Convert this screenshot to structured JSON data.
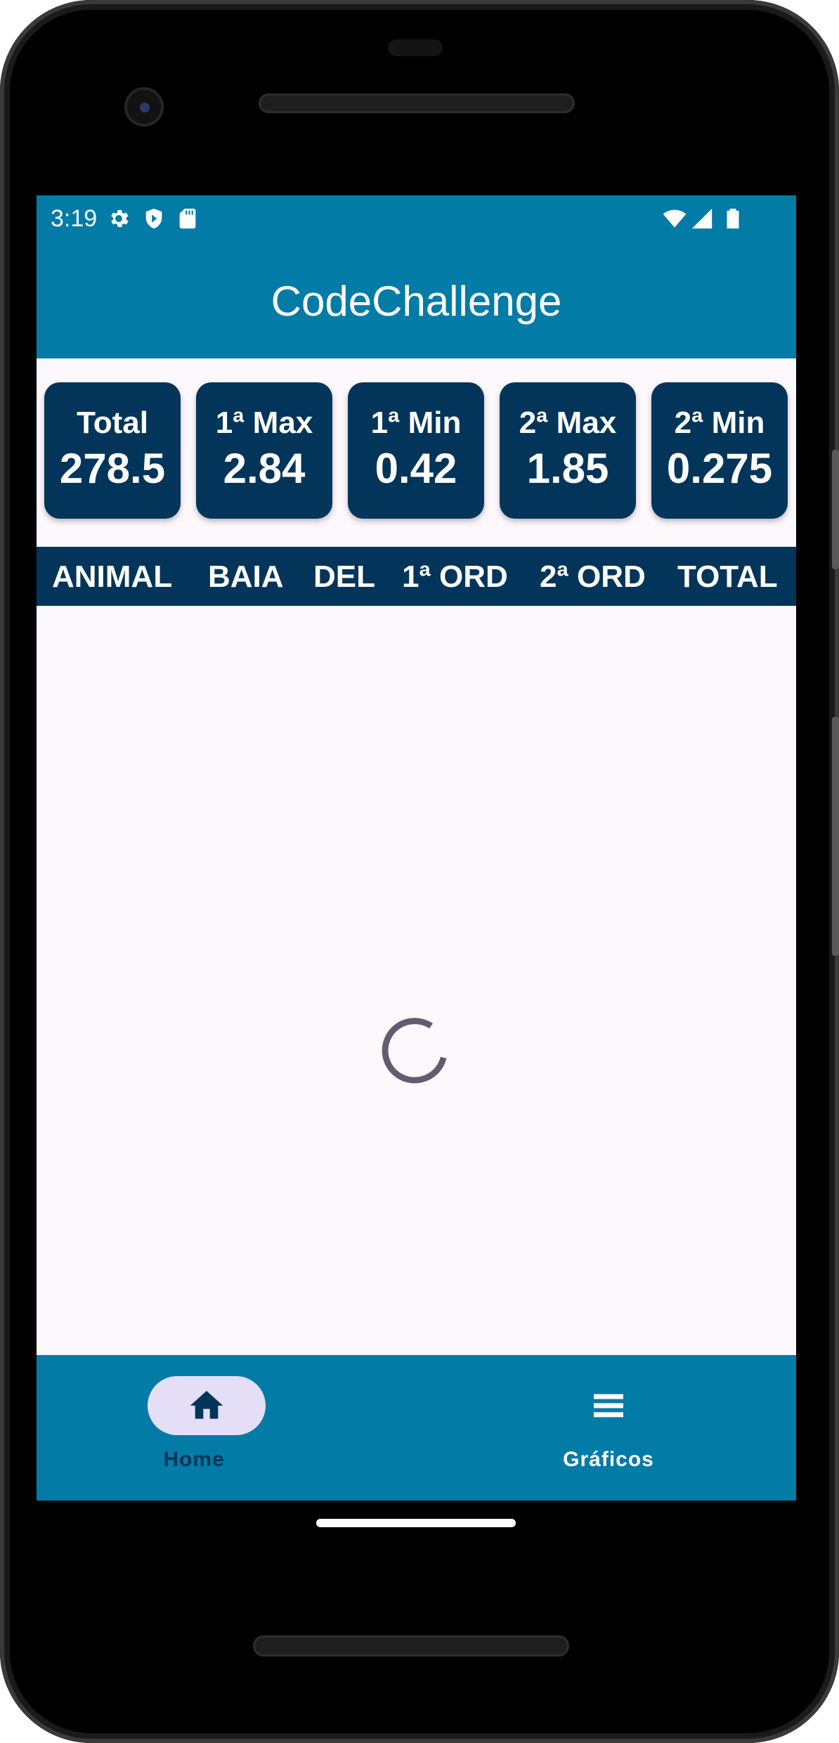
{
  "status_bar": {
    "time": "3:19"
  },
  "app_bar": {
    "title": "CodeChallenge"
  },
  "stats": [
    {
      "label": "Total",
      "value": "278.5"
    },
    {
      "label": "1ª Max",
      "value": "2.84"
    },
    {
      "label": "1ª Min",
      "value": "0.42"
    },
    {
      "label": "2ª Max",
      "value": "1.85"
    },
    {
      "label": "2ª Min",
      "value": "0.275"
    }
  ],
  "table": {
    "columns": [
      "ANIMAL",
      "BAIA",
      "DEL",
      "1ª ORD",
      "2ª ORD",
      "TOTAL"
    ]
  },
  "loading": {
    "icon": "progress-spinner-icon"
  },
  "bottom_nav": {
    "items": [
      {
        "label": "Home",
        "icon": "home-icon",
        "selected": true
      },
      {
        "label": "Gráficos",
        "icon": "list-icon",
        "selected": false
      }
    ]
  },
  "colors": {
    "primary": "#027ba7",
    "card": "#03355a",
    "background": "#fcf8fc",
    "nav_pill": "#e4dff7",
    "spinner": "#625b71"
  }
}
